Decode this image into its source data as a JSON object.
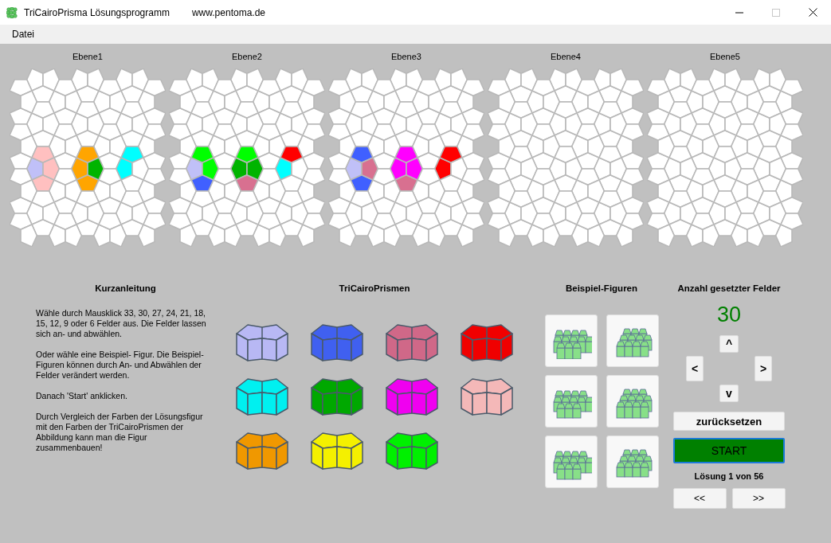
{
  "window": {
    "title": "TriCairoPrisma Lösungsprogramm",
    "subtitle": "www.pentoma.de",
    "maximize_disabled": true
  },
  "menu": [
    "Datei"
  ],
  "layers": [
    {
      "label": "Ebene1",
      "cells": [
        {
          "color": "#c0c0f8"
        },
        {
          "color": "#ffc0c0"
        },
        {
          "color": "#ffc0c0"
        },
        {
          "color": "#ffc0c0"
        },
        {
          "color": "#ffa500"
        },
        {
          "color": "#ffa500"
        },
        {
          "color": "#ffa500"
        },
        {
          "color": "#00b400"
        },
        {
          "color": "#00ffff"
        },
        {
          "color": "#00ffff"
        }
      ]
    },
    {
      "label": "Ebene2",
      "cells": [
        {
          "color": "#c0c0f8"
        },
        {
          "color": "#00ff00"
        },
        {
          "color": "#4060ff"
        },
        {
          "color": "#00ff00"
        },
        {
          "color": "#00b400"
        },
        {
          "color": "#00ff00"
        },
        {
          "color": "#d87090"
        },
        {
          "color": "#00b400"
        },
        {
          "color": "#00ffff"
        },
        {
          "color": "#ff0000"
        }
      ]
    },
    {
      "label": "Ebene3",
      "cells": [
        {
          "color": "#c0c0f8"
        },
        {
          "color": "#4060ff"
        },
        {
          "color": "#4060ff"
        },
        {
          "color": "#d87090"
        },
        {
          "color": "#ff00ff"
        },
        {
          "color": "#ff00ff"
        },
        {
          "color": "#d87090"
        },
        {
          "color": "#ff00ff"
        },
        {
          "color": "#ff0000"
        },
        {
          "color": "#ff0000"
        }
      ]
    },
    {
      "label": "Ebene4"
    },
    {
      "label": "Ebene5"
    }
  ],
  "instructions": {
    "title": "Kurzanleitung",
    "paragraphs": [
      "Wähle durch Mausklick 33, 30, 27, 24, 21, 18, 15, 12, 9 oder 6 Felder aus. Die Felder lassen sich an- und abwählen.",
      "Oder wähle eine Beispiel- Figur. Die Beispiel-Figuren können durch An- und Abwählen der Felder verändert werden.",
      "Danach 'Start' anklicken.",
      "Durch Vergleich der Farben der Lösungsfigur mit den Farben der TriCairoPrismen der Abbildung kann man die Figur zusammenbauen!"
    ]
  },
  "prisms": {
    "title": "TriCairoPrismen",
    "items": [
      {
        "color": "#b8b8f4"
      },
      {
        "color": "#4060f0"
      },
      {
        "color": "#d06888"
      },
      {
        "color": "#f00000"
      },
      {
        "color": "#00f0f0"
      },
      {
        "color": "#00a800"
      },
      {
        "color": "#f000f0"
      },
      {
        "color": "#f4b8b8"
      },
      {
        "color": "#f09800"
      },
      {
        "color": "#f4f000"
      },
      {
        "color": "#00f000"
      }
    ]
  },
  "examples": {
    "title": "Beispiel-Figuren"
  },
  "controls": {
    "counter_label": "Anzahl gesetzter Felder",
    "counter": "30",
    "arrows": [
      "^",
      "<",
      ">",
      "v"
    ],
    "reset": "zurücksetzen",
    "start": "START",
    "solution": "Lösung 1 von 56",
    "prev": "<<",
    "next": ">>"
  }
}
